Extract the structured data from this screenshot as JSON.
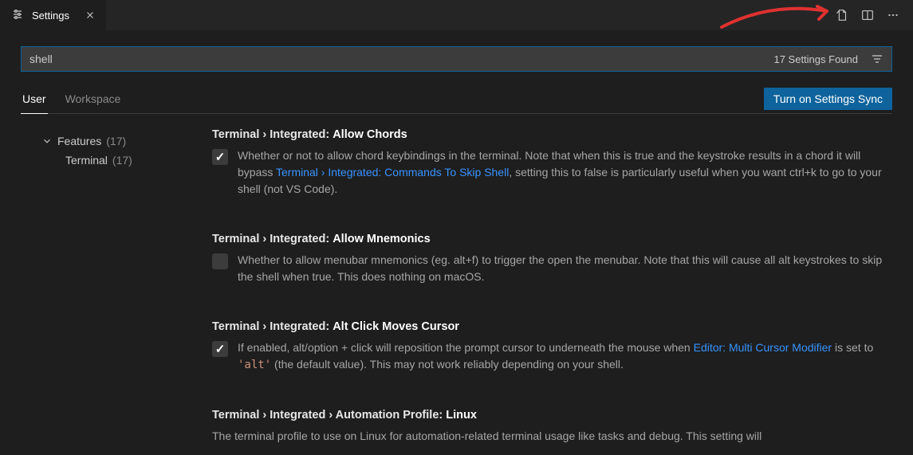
{
  "tab": {
    "title": "Settings"
  },
  "search": {
    "value": "shell",
    "count_label": "17 Settings Found"
  },
  "scopes": {
    "user": "User",
    "workspace": "Workspace"
  },
  "sync_button": "Turn on Settings Sync",
  "tree": {
    "features_label": "Features",
    "features_count": "(17)",
    "terminal_label": "Terminal",
    "terminal_count": "(17)"
  },
  "settings": [
    {
      "prefix": "Terminal › Integrated:",
      "name": "Allow Chords",
      "checked": true,
      "desc_pre": "Whether or not to allow chord keybindings in the terminal. Note that when this is true and the keystroke results in a chord it will bypass ",
      "link": "Terminal › Integrated: Commands To Skip Shell",
      "desc_post": ", setting this to false is particularly useful when you want ctrl+k to go to your shell (not VS Code)."
    },
    {
      "prefix": "Terminal › Integrated:",
      "name": "Allow Mnemonics",
      "checked": false,
      "desc_pre": "Whether to allow menubar mnemonics (eg. alt+f) to trigger the open the menubar. Note that this will cause all alt keystrokes to skip the shell when true. This does nothing on macOS."
    },
    {
      "prefix": "Terminal › Integrated:",
      "name": "Alt Click Moves Cursor",
      "checked": true,
      "desc_pre": "If enabled, alt/option + click will reposition the prompt cursor to underneath the mouse when ",
      "link": "Editor: Multi Cursor Modifier",
      "desc_mid": " is set to ",
      "code": "'alt'",
      "desc_post": " (the default value). This may not work reliably depending on your shell."
    },
    {
      "prefix": "Terminal › Integrated › Automation Profile:",
      "name": "Linux",
      "no_checkbox": true,
      "desc_pre": "The terminal profile to use on Linux for automation-related terminal usage like tasks and debug. This setting will"
    }
  ]
}
